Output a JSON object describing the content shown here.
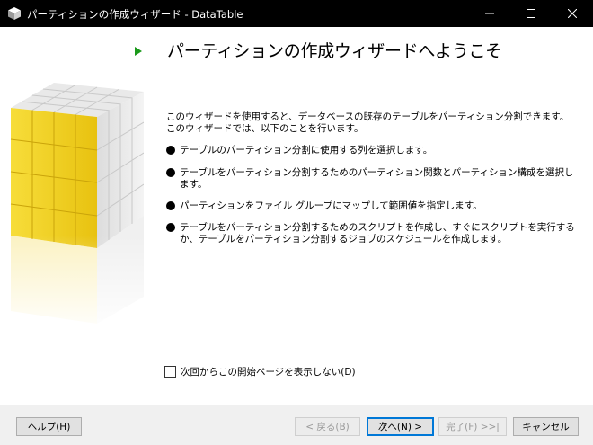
{
  "window": {
    "title": "パーティションの作成ウィザード - DataTable",
    "controls": {
      "minimize": "—",
      "maximize": "☐",
      "close": "✕"
    }
  },
  "page": {
    "heading": "パーティションの作成ウィザードへようこそ",
    "intro_line1": "このウィザードを使用すると、データベースの既存のテーブルをパーティション分割できます。",
    "intro_line2": "このウィザードでは、以下のことを行います。",
    "bullets": [
      "テーブルのパーティション分割に使用する列を選択します。",
      "テーブルをパーティション分割するためのパーティション関数とパーティション構成を選択します。",
      "パーティションをファイル グループにマップして範囲値を指定します。",
      "テーブルをパーティション分割するためのスクリプトを作成し、すぐにスクリプトを実行するか、テーブルをパーティション分割するジョブのスケジュールを作成します。"
    ],
    "checkbox_label": "次回からこの開始ページを表示しない(D)",
    "checkbox_checked": false
  },
  "buttons": {
    "help": "ヘルプ(H)",
    "back": "< 戻る(B)",
    "next": "次へ(N) >",
    "finish": "完了(F) >>|",
    "cancel": "キャンセル"
  },
  "colors": {
    "accent_arrow": "#1b9a1b",
    "cube_yellow": "#f5d21a",
    "titlebar": "#000000"
  }
}
